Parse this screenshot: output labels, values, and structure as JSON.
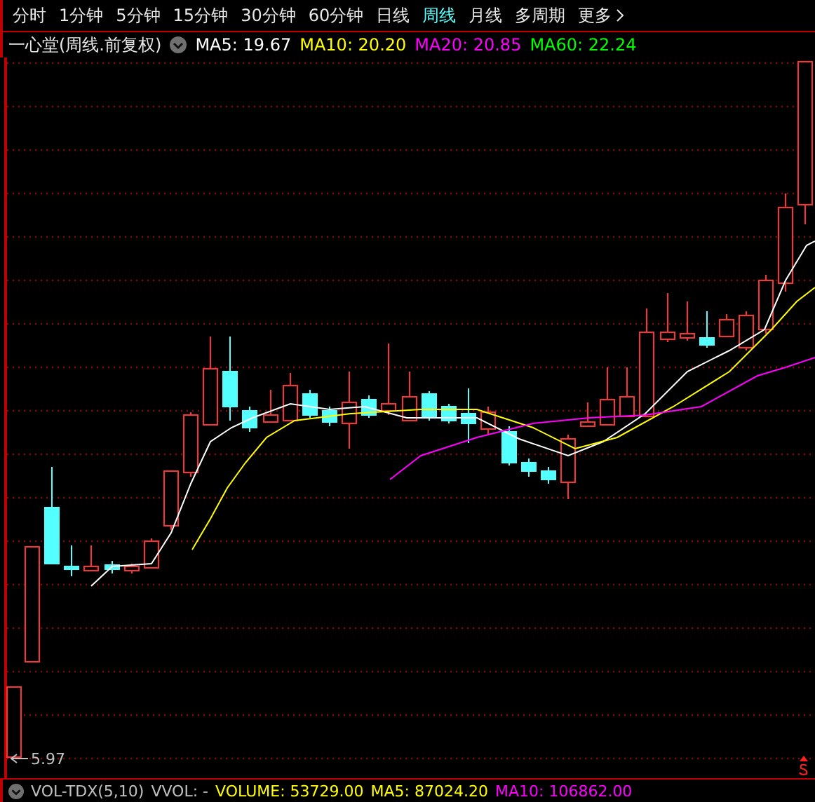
{
  "tabs": [
    {
      "label": "分时",
      "selected": false
    },
    {
      "label": "1分钟",
      "selected": false
    },
    {
      "label": "5分钟",
      "selected": false
    },
    {
      "label": "15分钟",
      "selected": false
    },
    {
      "label": "30分钟",
      "selected": false
    },
    {
      "label": "60分钟",
      "selected": false
    },
    {
      "label": "日线",
      "selected": false
    },
    {
      "label": "周线",
      "selected": true
    },
    {
      "label": "月线",
      "selected": false
    },
    {
      "label": "多周期",
      "selected": false
    },
    {
      "label": "更多",
      "selected": false
    }
  ],
  "legend": {
    "title": "一心堂(周线.前复权)",
    "items": [
      {
        "text": "MA5: 19.67",
        "color": "#ffffff"
      },
      {
        "text": "MA10: 20.20",
        "color": "#ffff00"
      },
      {
        "text": "MA20: 20.85",
        "color": "#ff00ff"
      },
      {
        "text": "MA60: 22.24",
        "color": "#00ff00"
      }
    ]
  },
  "chart": {
    "low_label": "5.97"
  },
  "volume_legend": {
    "items": [
      {
        "text": "VOL-TDX(5,10)",
        "color": "#c0c0c0"
      },
      {
        "text": "VVOL: -",
        "color": "#c0c0c0"
      },
      {
        "text": "VOLUME: 53729.00",
        "color": "#ffff00"
      },
      {
        "text": "MA5: 87024.20",
        "color": "#ffff00"
      },
      {
        "text": "MA10: 106862.00",
        "color": "#ff00ff"
      }
    ]
  }
}
